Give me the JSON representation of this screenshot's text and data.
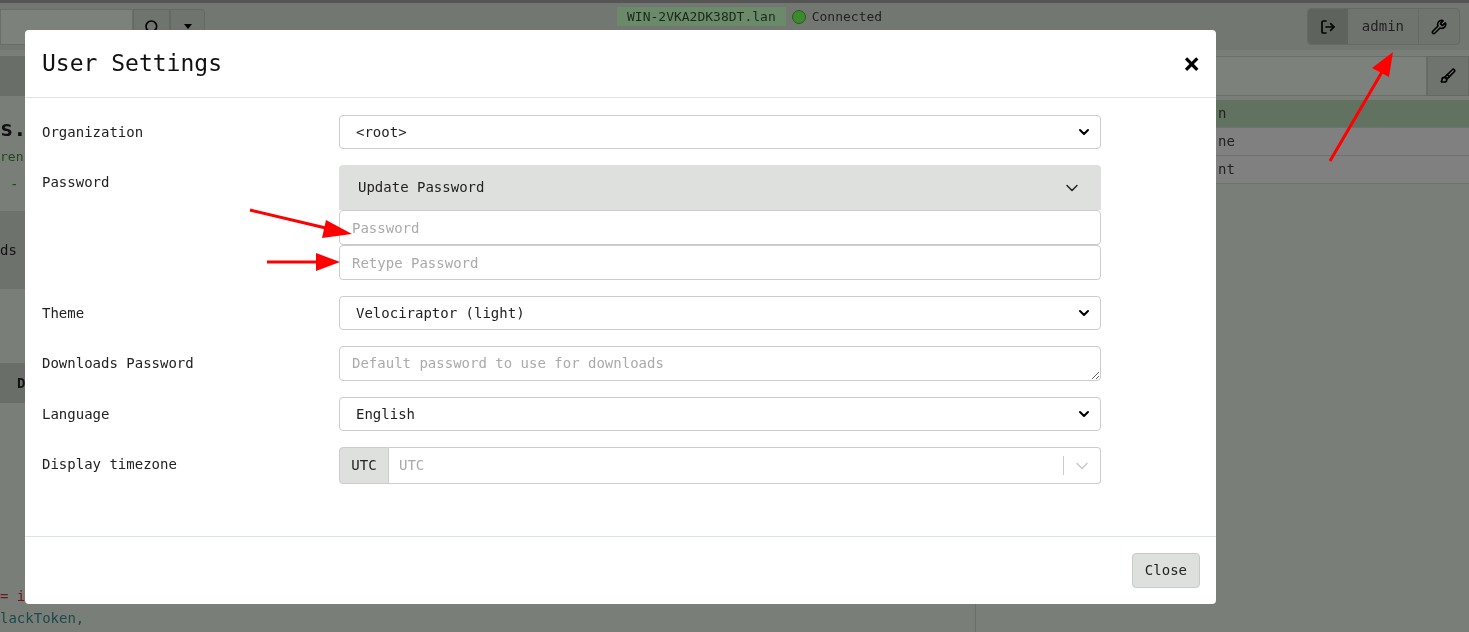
{
  "topbar": {
    "host": "WIN-2VKA2DK38DT.lan",
    "status": "Connected",
    "user": "admin"
  },
  "background": {
    "heading": "s.",
    "line_1": "ren",
    "line_2": "-",
    "banner": "ds",
    "table_header": "D",
    "code_1": "= i",
    "code_2": "lackToken,",
    "list": [
      {
        "text": "n",
        "selected": true
      },
      {
        "text": "ne",
        "selected": false
      },
      {
        "text": "nt",
        "selected": false
      }
    ]
  },
  "dialog": {
    "title": "User Settings",
    "close": "×",
    "fields": [
      {
        "label": "Organization",
        "kind": "select",
        "value": "<root>"
      },
      {
        "label": "Password",
        "kind": "password",
        "toggle": "Update Password",
        "expanded": true,
        "inputs": [
          {
            "placeholder": "Password"
          },
          {
            "placeholder": "Retype Password"
          }
        ]
      },
      {
        "label": "Theme",
        "kind": "select",
        "value": "Velociraptor (light)"
      },
      {
        "label": "Downloads Password",
        "kind": "textarea",
        "placeholder": "Default password to use for downloads"
      },
      {
        "label": "Language",
        "kind": "select",
        "value": "English"
      },
      {
        "label": "Display timezone",
        "kind": "timezone",
        "addon": "UTC",
        "placeholder": "UTC"
      }
    ],
    "buttons": [
      "Close"
    ]
  }
}
